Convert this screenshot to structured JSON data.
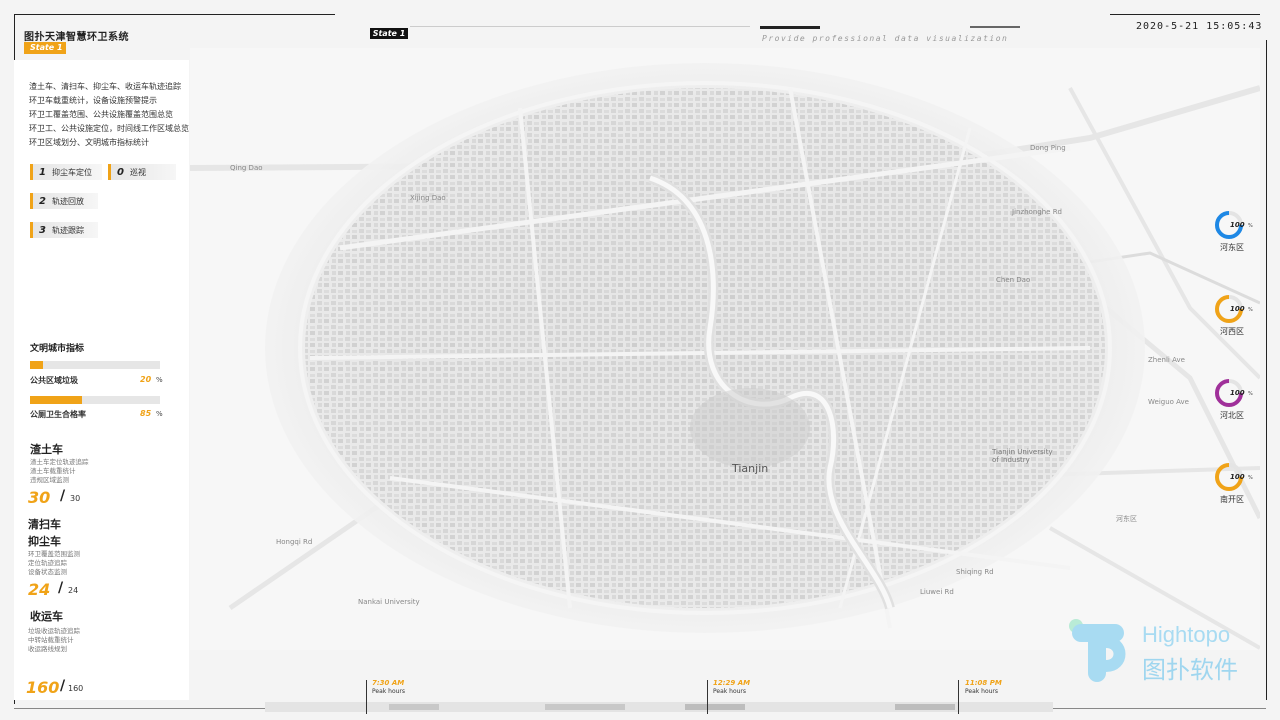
{
  "header": {
    "title": "图扑天津智慧环卫系统",
    "state_left": "State 1",
    "state_center": "State 1",
    "subtitle": "Provide professional data visualization",
    "datetime": "2020-5-21 15:05:43"
  },
  "features": [
    "渣土车、清扫车、抑尘车、收运车轨迹追踪",
    "环卫车载重统计，设备设施预警提示",
    "环卫工覆盖范围、公共设施覆盖范围总览",
    "环卫工、公共设施定位，时间线工作区域总览",
    "环卫区域划分、文明城市指标统计"
  ],
  "menu": [
    {
      "num": "1",
      "label": "抑尘车定位"
    },
    {
      "num": "0",
      "label": "巡视"
    },
    {
      "num": "2",
      "label": "轨迹回放"
    },
    {
      "num": "3",
      "label": "轨迹跟踪"
    }
  ],
  "civilized_index": {
    "title": "文明城市指标",
    "items": [
      {
        "label": "公共区域垃圾",
        "value": "20",
        "unit": "%",
        "fraction": 0.1
      },
      {
        "label": "公厕卫生合格率",
        "value": "85",
        "unit": "%",
        "fraction": 0.4
      }
    ]
  },
  "vehicles": [
    {
      "title": "渣土车",
      "desc": [
        "渣土车定位轨迹追踪",
        "渣土车载重统计",
        "违规区域监测"
      ],
      "count": "30",
      "total": "30"
    },
    {
      "title": "清扫车",
      "desc": [],
      "count": "",
      "total": ""
    },
    {
      "title": "抑尘车",
      "desc": [
        "环卫覆盖范围监测",
        "定位轨迹追踪",
        "设备状态监测"
      ],
      "count": "24",
      "total": "24"
    },
    {
      "title": "收运车",
      "desc": [
        "垃圾收运轨迹追踪",
        "中转站载重统计",
        "收运路线规划"
      ],
      "count": "",
      "total": ""
    }
  ],
  "bottom_total": {
    "count": "160",
    "total": "160"
  },
  "districts": [
    {
      "name": "河东区",
      "value": "100",
      "unit": "%",
      "color": "#1e88e5"
    },
    {
      "name": "河西区",
      "value": "100",
      "unit": "%",
      "color": "#f0a318"
    },
    {
      "name": "河北区",
      "value": "100",
      "unit": "%",
      "color": "#a0309a"
    },
    {
      "name": "南开区",
      "value": "100",
      "unit": "%",
      "color": "#f0a318"
    }
  ],
  "timeline": [
    {
      "time": "7:30 AM",
      "label": "Peak hours"
    },
    {
      "time": "12:29 AM",
      "label": "Peak hours"
    },
    {
      "time": "11:08 PM",
      "label": "Peak hours"
    }
  ],
  "map_labels": {
    "xijing": "Xijing Dao",
    "nankai": "Nankai University",
    "tianjin_univ": "Tianjin University\nof Industry",
    "hedong": "河东区",
    "zhenli": "Zhenli Ave",
    "weiguo": "Weiguo Ave",
    "chen_dao": "Chen Dao",
    "dongping": "Dong Ping",
    "shiqing": "Shiqing Rd",
    "hongqi": "Hongqi Rd",
    "jinzhonghe": "Jinzhonghe Rd",
    "liuwei": "Liuwei Rd",
    "qing_dao": "Qing Dao",
    "tianjin": "Tianjin"
  },
  "logo": {
    "en": "Hightopo",
    "cn": "图扑软件"
  }
}
